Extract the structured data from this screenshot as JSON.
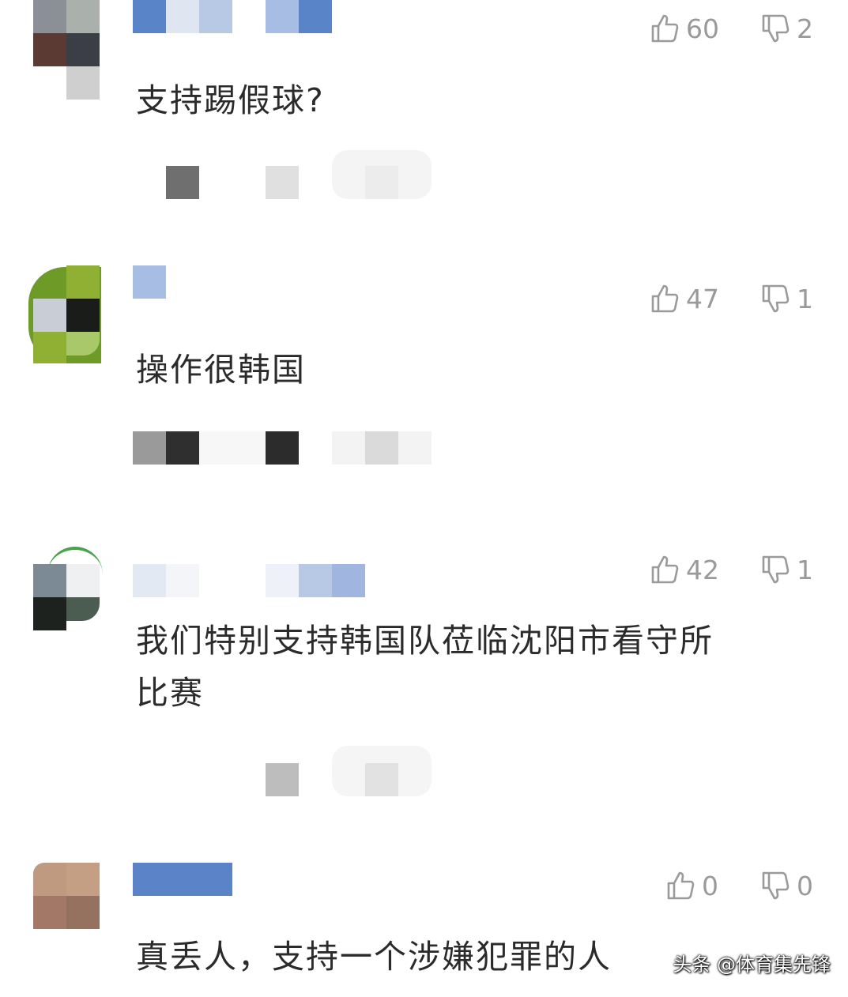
{
  "comments": [
    {
      "text": "支持踢假球?",
      "likes": "60",
      "dislikes": "2"
    },
    {
      "text": "操作很韩国",
      "likes": "47",
      "dislikes": "1"
    },
    {
      "text_line1": "我们特别支持韩国队莅临沈阳市看守所",
      "text_line2": "比赛",
      "likes": "42",
      "dislikes": "1"
    },
    {
      "text": "真丢人，支持一个涉嫌犯罪的人",
      "likes": "0",
      "dislikes": "0"
    }
  ],
  "icons": {
    "like": "thumbs-up-icon",
    "dislike": "thumbs-down-icon"
  },
  "watermark": "头条 @体育集先锋"
}
